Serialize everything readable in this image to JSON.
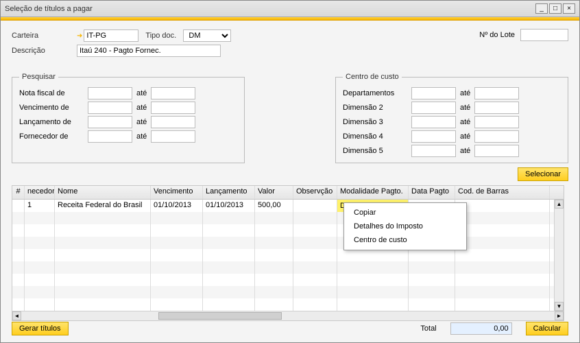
{
  "window": {
    "title": "Seleção de títulos a pagar"
  },
  "toolbar": {
    "min": "_",
    "max": "□",
    "close": "×"
  },
  "form": {
    "carteira_label": "Carteira",
    "carteira_value": "IT-PG",
    "tipodoc_label": "Tipo doc.",
    "tipodoc_value": "DM",
    "descricao_label": "Descrição",
    "descricao_value": "Itaú 240 - Pagto Fornec.",
    "lote_label": "Nº do Lote",
    "lote_value": ""
  },
  "pesquisar": {
    "legend": "Pesquisar",
    "ate": "até",
    "rows": [
      {
        "label": "Nota fiscal de"
      },
      {
        "label": "Vencimento de"
      },
      {
        "label": "Lançamento de"
      },
      {
        "label": "Fornecedor de"
      }
    ]
  },
  "centro": {
    "legend": "Centro de custo",
    "ate": "até",
    "rows": [
      {
        "label": "Departamentos"
      },
      {
        "label": "Dimensão 2"
      },
      {
        "label": "Dimensão 3"
      },
      {
        "label": "Dimensão 4"
      },
      {
        "label": "Dimensão 5"
      }
    ]
  },
  "buttons": {
    "selecionar": "Selecionar",
    "gerar": "Gerar títulos",
    "calcular": "Calcular"
  },
  "grid": {
    "headers": {
      "num": "#",
      "necedor": "necedor",
      "nome": "Nome",
      "venc": "Vencimento",
      "lanc": "Lançamento",
      "valor": "Valor",
      "obs": "Observção",
      "mod": "Modalidade Pagto.",
      "data": "Data Pagto",
      "bar": "Cod. de Barras"
    },
    "rows": [
      {
        "necedor": "1",
        "nome": "Receita Federal do Brasil",
        "venc": "01/10/2013",
        "lanc": "01/10/2013",
        "valor": "500,00",
        "obs": "",
        "mod": "DARF",
        "data": "",
        "bar": ""
      }
    ]
  },
  "context": {
    "items": [
      "Copiar",
      "Detalhes do Imposto",
      "Centro de custo"
    ]
  },
  "footer": {
    "total_label": "Total",
    "total_value": "0,00"
  }
}
